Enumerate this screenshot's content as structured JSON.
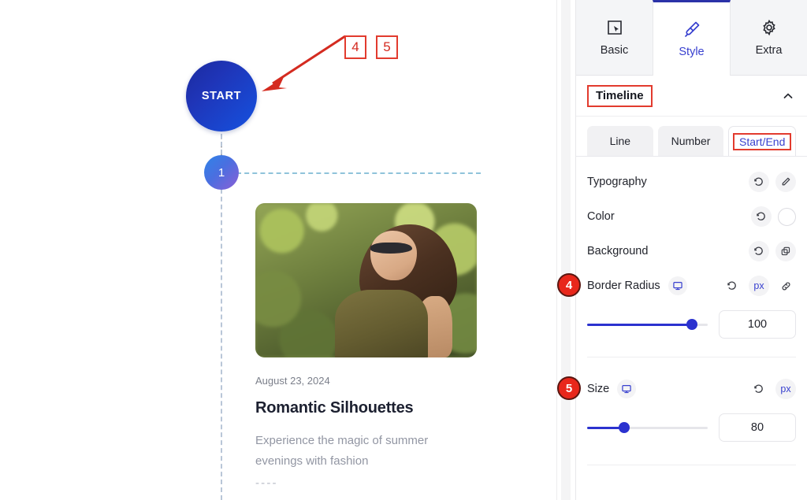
{
  "canvas": {
    "start_node": {
      "label": "START"
    },
    "node_1": {
      "label": "1"
    },
    "card": {
      "date": "August 23, 2024",
      "title": "Romantic Silhouettes",
      "description": "Experience the magic of summer evenings with fashion",
      "trailing_dashes": "- - - -",
      "photo_alt": "woman-with-sunglasses-in-park"
    },
    "annotations": {
      "box_4": "4",
      "box_5": "5",
      "arrow_color": "#d42b20"
    }
  },
  "panel": {
    "tabs": [
      {
        "label": "Basic",
        "icon": "cursor-select-icon",
        "active": false
      },
      {
        "label": "Style",
        "icon": "paintbrush-icon",
        "active": true
      },
      {
        "label": "Extra",
        "icon": "gear-icon",
        "active": false
      }
    ],
    "section": {
      "title": "Timeline",
      "collapse_icon": "chevron-up-icon"
    },
    "subtabs": [
      {
        "label": "Line",
        "active": false
      },
      {
        "label": "Number",
        "active": false
      },
      {
        "label": "Start/End",
        "active": true
      }
    ],
    "rows": [
      {
        "label": "Typography",
        "controls": [
          "reset-icon",
          "pencil-edit-icon"
        ]
      },
      {
        "label": "Color",
        "controls": [
          "reset-icon",
          "color-swatch"
        ],
        "swatch_color": "#ffffff"
      },
      {
        "label": "Background",
        "controls": [
          "reset-icon",
          "layers-copy-icon"
        ]
      }
    ],
    "border_radius": {
      "label": "Border Radius",
      "device_icon": "desktop-monitor-icon",
      "controls": [
        "reset-icon",
        "unit-px",
        "link-chain-icon"
      ],
      "unit": "px",
      "value": "100",
      "slider_percent": 87
    },
    "size": {
      "label": "Size",
      "device_icon": "desktop-monitor-icon",
      "controls": [
        "reset-icon",
        "unit-px"
      ],
      "unit": "px",
      "value": "80",
      "slider_percent": 31
    },
    "badges": {
      "badge_4": "4",
      "badge_5": "5"
    },
    "accent_color": "#3840cf",
    "annotation_color": "#e23b2e"
  }
}
